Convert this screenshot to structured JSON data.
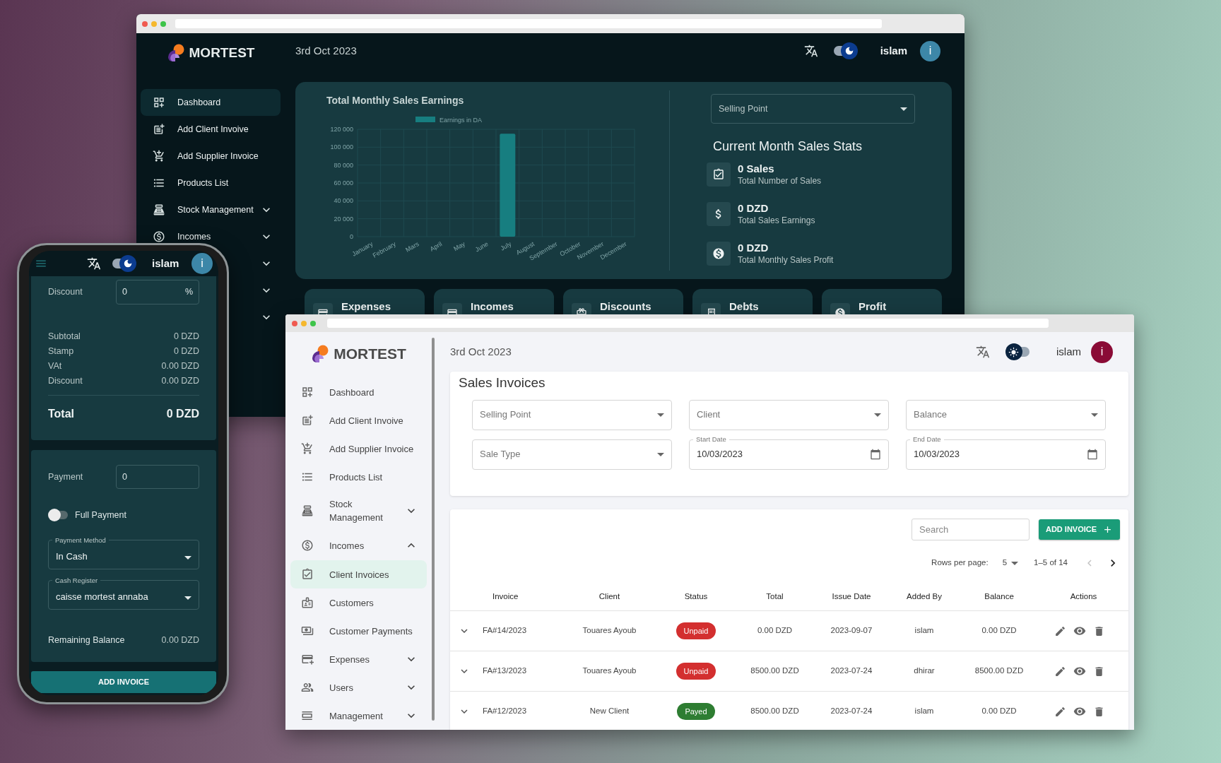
{
  "dark_window": {
    "logo": "MORTEST",
    "date": "3rd Oct 2023",
    "user": "islam",
    "avatar_letter": "i",
    "dark_mode": true,
    "sidebar": [
      {
        "label": "Dashboard",
        "selected": true,
        "expandable": false
      },
      {
        "label": "Add Client Invoive",
        "selected": false,
        "expandable": false
      },
      {
        "label": "Add Supplier Invoice",
        "selected": false,
        "expandable": false
      },
      {
        "label": "Products List",
        "selected": false,
        "expandable": false
      },
      {
        "label": "Stock Management",
        "selected": false,
        "expandable": true,
        "expanded": false
      },
      {
        "label": "Incomes",
        "selected": false,
        "expandable": true,
        "expanded": false
      },
      {
        "selected": false,
        "expandable": true,
        "expanded": false
      },
      {
        "selected": false,
        "expandable": true,
        "expanded": false
      },
      {
        "selected": false,
        "expandable": true,
        "expanded": false
      }
    ],
    "sales_panel": {
      "title": "Total Monthly Sales Earnings",
      "chart_data": {
        "type": "bar",
        "grid": true,
        "categories": [
          "January",
          "February",
          "Mars",
          "April",
          "May",
          "June",
          "July",
          "August",
          "September",
          "October",
          "November",
          "December"
        ],
        "series": [
          {
            "name": "Earnings in DA",
            "color": "#177e80",
            "values": [
              0,
              0,
              0,
              0,
              0,
              0,
              115000,
              0,
              0,
              0,
              0,
              0
            ]
          }
        ],
        "ylim": [
          0,
          120000
        ],
        "yticks": [
          {
            "value": 0,
            "label": "0"
          },
          {
            "value": 20000,
            "label": "20 000"
          },
          {
            "value": 40000,
            "label": "40 000"
          },
          {
            "value": 60000,
            "label": "60 000"
          },
          {
            "value": 80000,
            "label": "80 000"
          },
          {
            "value": 100000,
            "label": "100 000"
          },
          {
            "value": 120000,
            "label": "120 000"
          }
        ]
      },
      "select": {
        "placeholder": "Selling Point"
      },
      "stats_title": "Current Month Sales Stats",
      "stats": [
        {
          "value": "0 Sales",
          "label": "Total Number of Sales"
        },
        {
          "value": "0 DZD",
          "label": "Total Sales Earnings"
        },
        {
          "value": "0 DZD",
          "label": "Total Monthly Sales Profit"
        }
      ]
    },
    "cards": [
      {
        "label": "Expenses"
      },
      {
        "label": "Incomes"
      },
      {
        "label": "Discounts"
      },
      {
        "label": "Debts"
      },
      {
        "label": "Profit"
      }
    ]
  },
  "phone": {
    "user": "islam",
    "avatar_letter": "i",
    "dark_mode": true,
    "discount": {
      "label": "Discount",
      "value": "0",
      "suffix": "%"
    },
    "summary": [
      {
        "label": "Subtotal",
        "value": "0 DZD"
      },
      {
        "label": "Stamp",
        "value": "0 DZD"
      },
      {
        "label": "VAt",
        "value": "0.00 DZD"
      },
      {
        "label": "Discount",
        "value": "0.00 DZD"
      }
    ],
    "total": {
      "label": "Total",
      "value": "0 DZD"
    },
    "payment": {
      "label": "Payment",
      "value": "0"
    },
    "full_payment": {
      "label": "Full Payment",
      "on": false
    },
    "selects": [
      {
        "label": "Payment Method",
        "value": "In Cash"
      },
      {
        "label": "Cash Register",
        "value": "caisse mortest annaba"
      }
    ],
    "remaining": {
      "label": "Remaining Balance",
      "value": "0.00 DZD"
    },
    "button": "ADD INVOICE"
  },
  "light_window": {
    "logo": "MORTEST",
    "date": "3rd Oct 2023",
    "user": "islam",
    "avatar_letter": "i",
    "dark_mode": false,
    "sidebar": [
      {
        "label": "Dashboard",
        "selected": false,
        "expandable": false
      },
      {
        "label": "Add Client Invoive",
        "selected": false,
        "expandable": false
      },
      {
        "label": "Add Supplier Invoice",
        "selected": false,
        "expandable": false
      },
      {
        "label": "Products List",
        "selected": false,
        "expandable": false
      },
      {
        "label": "Stock Management",
        "selected": false,
        "expandable": true,
        "expanded": false
      },
      {
        "label": "Incomes",
        "selected": false,
        "expandable": true,
        "expanded": true
      },
      {
        "label": "Client Invoices",
        "selected": true,
        "expandable": false
      },
      {
        "label": "Customers",
        "selected": false,
        "expandable": false
      },
      {
        "label": "Customer Payments",
        "selected": false,
        "expandable": false
      },
      {
        "label": "Expenses",
        "selected": false,
        "expandable": true,
        "expanded": false
      },
      {
        "label": "Users",
        "selected": false,
        "expandable": true,
        "expanded": false
      },
      {
        "label": "Management",
        "selected": false,
        "expandable": true,
        "expanded": false
      }
    ],
    "filters": {
      "title": "Sales Invoices",
      "fields": [
        {
          "kind": "select",
          "placeholder": "Selling Point"
        },
        {
          "kind": "select",
          "placeholder": "Client"
        },
        {
          "kind": "select",
          "placeholder": "Balance"
        },
        {
          "kind": "select",
          "placeholder": "Sale Type"
        },
        {
          "kind": "date",
          "label": "Start Date",
          "value": "10/03/2023"
        },
        {
          "kind": "date",
          "label": "End Date",
          "value": "10/03/2023"
        }
      ]
    },
    "table": {
      "search": {
        "placeholder": "Search"
      },
      "add_button": "ADD INVOICE",
      "pagination": {
        "label": "Rows per page:",
        "rows": "5",
        "range": "1–5 of 14",
        "prev_disabled": true,
        "next_disabled": false
      },
      "columns": [
        "Invoice",
        "Client",
        "Status",
        "Total",
        "Issue Date",
        "Added By",
        "Balance",
        "Actions"
      ],
      "rows": [
        {
          "expanded": false,
          "invoice": "FA#14/2023",
          "client": "Touares Ayoub",
          "status": {
            "label": "Unpaid",
            "color": "#d32f2f"
          },
          "total": "0.00 DZD",
          "issue_date": "2023-09-07",
          "added_by": "islam",
          "balance": "0.00 DZD"
        },
        {
          "expanded": false,
          "invoice": "FA#13/2023",
          "client": "Touares Ayoub",
          "status": {
            "label": "Unpaid",
            "color": "#d32f2f"
          },
          "total": "8500.00 DZD",
          "issue_date": "2023-07-24",
          "added_by": "dhirar",
          "balance": "8500.00 DZD"
        },
        {
          "expanded": false,
          "invoice": "FA#12/2023",
          "client": "New Client",
          "status": {
            "label": "Payed",
            "color": "#2e7d32"
          },
          "total": "8500.00 DZD",
          "issue_date": "2023-07-24",
          "added_by": "islam",
          "balance": "0.00 DZD"
        }
      ]
    }
  }
}
